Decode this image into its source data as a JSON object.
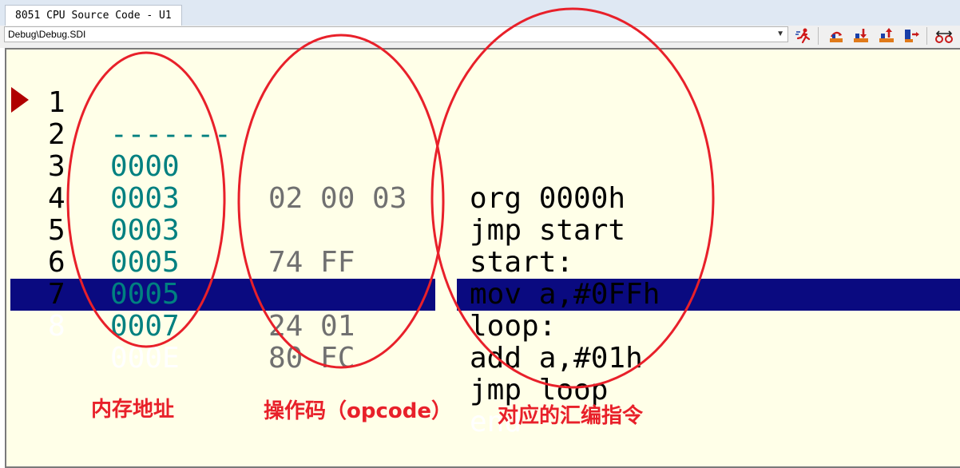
{
  "window": {
    "tab_title": "8051 CPU Source Code - U1",
    "file_path": "Debug\\Debug.SDI"
  },
  "toolbar": {
    "icons": [
      "run-icon",
      "step-over-icon",
      "step-into-icon",
      "step-out-icon",
      "run-to-cursor-icon",
      "breakpoint-toggle-icon"
    ]
  },
  "code": {
    "current_line": 2,
    "highlighted_line": 8,
    "lines": [
      {
        "num": "1",
        "addr": "-------",
        "opcode": "",
        "source": "org 0000h"
      },
      {
        "num": "2",
        "addr": "0000",
        "opcode": "02 00 03",
        "source": "jmp start"
      },
      {
        "num": "3",
        "addr": "0003",
        "opcode": "",
        "source": "start:"
      },
      {
        "num": "4",
        "addr": "0003",
        "opcode": "74 FF",
        "source": "mov a,#0FFh"
      },
      {
        "num": "5",
        "addr": "0005",
        "opcode": "",
        "source": "loop:"
      },
      {
        "num": "6",
        "addr": "0005",
        "opcode": "24 01",
        "source": "add a,#01h"
      },
      {
        "num": "7",
        "addr": "0007",
        "opcode": "80 FC",
        "source": "jmp loop"
      },
      {
        "num": "8",
        "addr": "000E",
        "opcode": "",
        "source": "end"
      }
    ]
  },
  "annotations": {
    "address_label": "内存地址",
    "opcode_label": "操作码（opcode）",
    "source_label": "对应的汇编指令",
    "color": "#e8202a"
  },
  "colors": {
    "editor_bg": "#ffffe8",
    "address": "#008080",
    "opcode": "#707070",
    "highlight": "#0a0a80",
    "arrow": "#b00000"
  }
}
